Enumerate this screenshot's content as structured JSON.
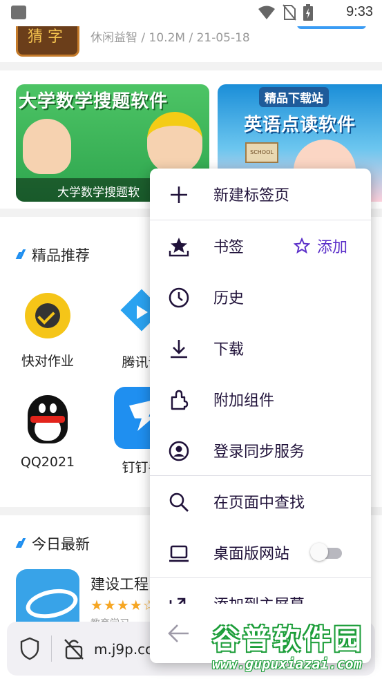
{
  "status_bar": {
    "time": "9:33"
  },
  "top_item": {
    "meta": "休闲益智 / 10.2M / 21-05-18",
    "thumb_text": "猜 字"
  },
  "banners": [
    {
      "title": "大学数学搜题软件",
      "caption": "大学数学搜题软"
    },
    {
      "tag": "精品下载站",
      "title": "英语点读软件",
      "school_sign": "SCHOOL"
    }
  ],
  "featured": {
    "title": "精品推荐",
    "apps": [
      {
        "name": "快对作业"
      },
      {
        "name": "腾讯课"
      },
      {
        "name": "QQ2021"
      },
      {
        "name": "钉钉手"
      }
    ]
  },
  "latest": {
    "title": "今日最新",
    "item": {
      "name": "建设工程",
      "stars": "★★★★☆",
      "sub": "教育学习"
    }
  },
  "url_bar": {
    "url": "m.j9p.co"
  },
  "menu": {
    "items": [
      {
        "label": "新建标签页",
        "icon": "plus-icon"
      },
      {
        "label": "书签",
        "icon": "bookmark-icon",
        "action": "添加"
      },
      {
        "label": "历史",
        "icon": "clock-icon"
      },
      {
        "label": "下载",
        "icon": "download-icon"
      },
      {
        "label": "附加组件",
        "icon": "puzzle-icon"
      },
      {
        "label": "登录同步服务",
        "icon": "account-icon"
      },
      {
        "label": "在页面中查找",
        "icon": "search-icon"
      },
      {
        "label": "桌面版网站",
        "icon": "laptop-icon",
        "toggle_on": false
      },
      {
        "label": "添加到主屏幕",
        "icon": "add-to-home-icon"
      }
    ]
  },
  "watermark": {
    "line1": "谷普软件园",
    "line2": "www.gupuxiazai.com"
  },
  "colors": {
    "accent": "#5b2fc9",
    "blue": "#1f8ff0",
    "menu_text": "#20123a"
  }
}
